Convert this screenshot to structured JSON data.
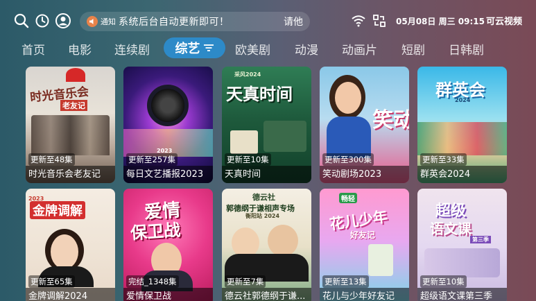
{
  "topbar": {
    "icons": [
      "search-icon",
      "history-icon",
      "user-icon",
      "wifi-icon",
      "screen-switch-icon"
    ],
    "notice_tag": "通知",
    "notice_text": "系统后台自动更新即可！",
    "notice_text_right": "请他",
    "datetime": "05月08日 周三 09:15",
    "brand": "可云视频"
  },
  "nav": {
    "items": [
      "首页",
      "电影",
      "连续剧",
      "综艺",
      "欧美剧",
      "动漫",
      "动画片",
      "短剧",
      "日韩剧"
    ],
    "active_index": 3
  },
  "cards": [
    {
      "title": "时光音乐会老友记",
      "status": "更新至48集",
      "art": "时光音乐会\n老友记"
    },
    {
      "title": "每日文艺播报2023",
      "status": "更新至257集",
      "art": "2023\n文艺播报"
    },
    {
      "title": "天真时间",
      "status": "更新至10集",
      "art": "天真时间"
    },
    {
      "title": "笑动剧场2023",
      "status": "更新至300集",
      "art": "笑动"
    },
    {
      "title": "群英会2024",
      "status": "更新至33集",
      "art": "群英会\n2024"
    },
    {
      "title": "金牌调解2024",
      "status": "更新至65集",
      "art": "金牌调解"
    },
    {
      "title": "爱情保卫战",
      "status": "完结_1348集",
      "art": "爱情\n保卫战"
    },
    {
      "title": "德云社郭德纲于谦...",
      "status": "更新至7集",
      "art": "德云社\n郭德纲于谦相声专场\n衡阳站 2024"
    },
    {
      "title": "花儿与少年好友记",
      "status": "更新至13集",
      "art": "花儿与少年\n好友记"
    },
    {
      "title": "超级语文课第三季",
      "status": "更新至10集",
      "art": "超级\n语文课"
    }
  ]
}
